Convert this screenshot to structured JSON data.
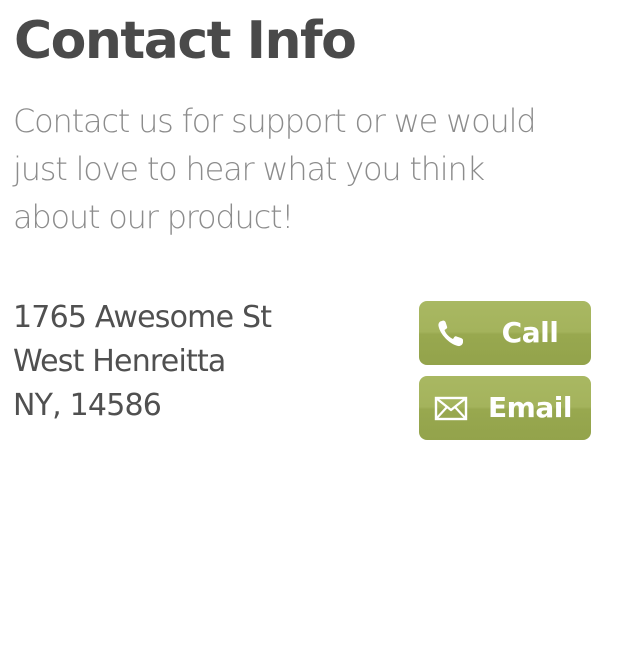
{
  "page": {
    "title": "Contact Info",
    "intro": "Contact us for support or we would just love to hear what you think about our product!"
  },
  "address": {
    "street": "1765 Awesome St",
    "city": "West Henreitta",
    "state_zip": "NY, 14586"
  },
  "actions": {
    "call": {
      "label": "Call",
      "icon": "phone-icon"
    },
    "email": {
      "label": "Email",
      "icon": "envelope-icon"
    }
  },
  "colors": {
    "button": "#a0b058",
    "title": "#4a4a4a",
    "intro": "#8c8c8c",
    "text": "#505050"
  }
}
